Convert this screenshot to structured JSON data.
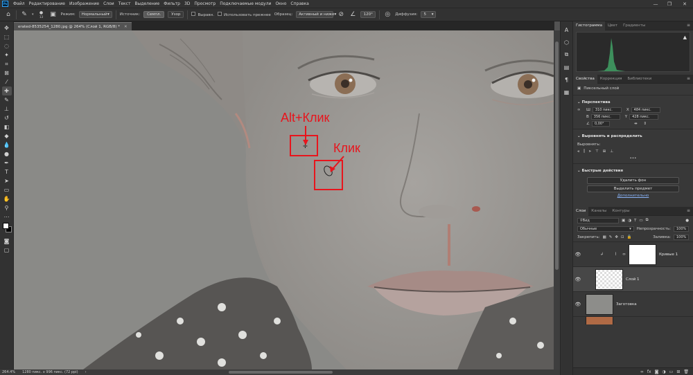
{
  "menubar": {
    "app_logo": "Ps",
    "items": [
      "Файл",
      "Редактирование",
      "Изображение",
      "Слои",
      "Текст",
      "Выделение",
      "Фильтр",
      "3D",
      "Просмотр",
      "Подключаемые модули",
      "Окно",
      "Справка"
    ],
    "window_controls": [
      "—",
      "❐",
      "✕"
    ]
  },
  "options": {
    "mode_label": "Режим:",
    "mode_value": "Нормальный",
    "source_label": "Источник:",
    "source_sample": "Семпл.",
    "source_pattern": "Узор",
    "aligned_label": "Выравн.",
    "use_legacy_label": "Использовать прежнее",
    "sample_label": "Образец:",
    "sample_value": "Активный и ниже",
    "brush_size": "13",
    "angle_value": "120°",
    "diffusion_label": "Диффузия:",
    "diffusion_value": "5"
  },
  "document": {
    "tab_title": "erated-8535254_1280.jpg @ 264% (Слой 1, RGB/8) *",
    "annotation_alt_click": "Alt+Клик",
    "annotation_click": "Клик"
  },
  "status": {
    "zoom": "264.4%",
    "doc_info": "1280 пикс. x 996 пикс. (72 ppi)"
  },
  "histogram_panel": {
    "tabs": [
      "Гистограмма",
      "Цвет",
      "Градиенты"
    ]
  },
  "properties_panel": {
    "tabs": [
      "Свойства",
      "Коррекция",
      "Библиотеки"
    ],
    "layer_type": "Пиксельный слой",
    "transform_title": "Перспектива",
    "w_label": "Ш",
    "w_value": "310 пикс.",
    "x_label": "X",
    "x_value": "484 пикс.",
    "h_label": "В",
    "h_value": "356 пикс.",
    "y_label": "Y",
    "y_value": "428 пикс.",
    "angle_value": "0,00°",
    "align_title": "Выровнять и распределить",
    "align_label": "Выровнять:",
    "more": "•••",
    "quick_title": "Быстрые действия",
    "remove_bg": "Удалить фон",
    "select_subject": "Выделить предмет",
    "more_link": "Дополнительно"
  },
  "layers_panel": {
    "tabs": [
      "Слои",
      "Каналы",
      "Контуры"
    ],
    "filter_label": "Вид",
    "blend_mode": "Обычные",
    "opacity_label": "Непрозрачность:",
    "opacity_value": "100%",
    "lock_label": "Закрепить:",
    "fill_label": "Заливка:",
    "fill_value": "100%",
    "layers": [
      {
        "name": "Кривые 1"
      },
      {
        "name": "Слой 1"
      },
      {
        "name": "Заготовка"
      }
    ]
  },
  "colors": {
    "annotation_red": "#e8141c",
    "panel_bg": "#383838",
    "chrome_bg": "#323232"
  }
}
